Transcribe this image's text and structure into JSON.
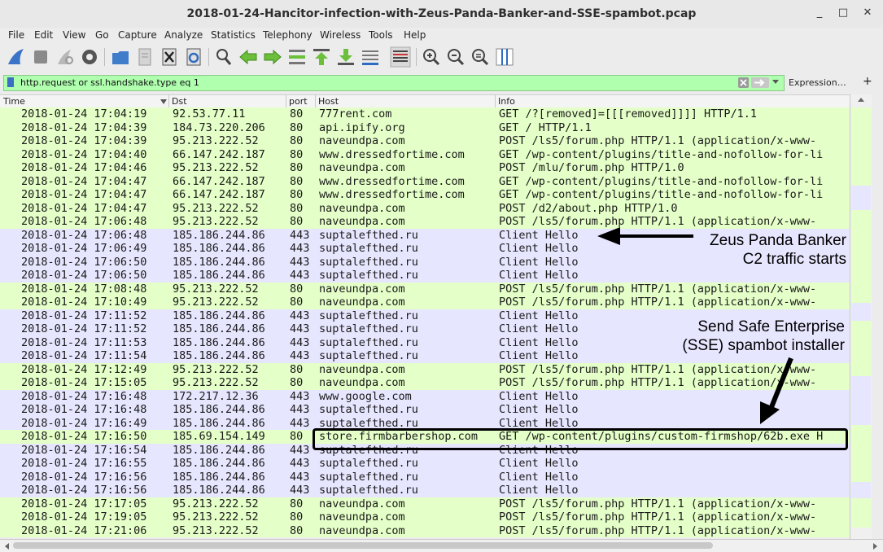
{
  "window": {
    "title": "2018-01-24-Hancitor-infection-with-Zeus-Panda-Banker-and-SSE-spambot.pcap",
    "minimize": "_",
    "maximize": "□",
    "close": "✕"
  },
  "menu": [
    "File",
    "Edit",
    "View",
    "Go",
    "Capture",
    "Analyze",
    "Statistics",
    "Telephony",
    "Wireless",
    "Tools",
    "Help"
  ],
  "toolbar_icons": [
    "shark-fin-icon",
    "stop-icon",
    "restart-icon",
    "options-icon",
    "open-file-icon",
    "file-icon",
    "close-file-icon",
    "reload-icon",
    "find-icon",
    "back-icon",
    "forward-icon",
    "goto-packet-icon",
    "first-packet-icon",
    "last-packet-icon",
    "autoscroll-icon",
    "colorize-icon",
    "zoom-in-icon",
    "zoom-out-icon",
    "zoom-reset-icon",
    "resize-columns-icon"
  ],
  "filter": {
    "value": "http.request or ssl.handshake.type eq 1",
    "expression_label": "Expression…",
    "add_label": "+"
  },
  "columns": {
    "time": "Time",
    "dst": "Dst",
    "port": "port",
    "host": "Host",
    "info": "Info"
  },
  "packets": [
    {
      "time": "2018-01-24 17:04:19",
      "dst": "92.53.77.11",
      "port": "80",
      "host": "777rent.com",
      "info": "GET /?[removed]=[[[removed]]]] HTTP/1.1",
      "type": "http"
    },
    {
      "time": "2018-01-24 17:04:39",
      "dst": "184.73.220.206",
      "port": "80",
      "host": "api.ipify.org",
      "info": "GET / HTTP/1.1",
      "type": "http"
    },
    {
      "time": "2018-01-24 17:04:39",
      "dst": "95.213.222.52",
      "port": "80",
      "host": "naveundpa.com",
      "info": "POST /ls5/forum.php HTTP/1.1  (application/x-www-",
      "type": "http"
    },
    {
      "time": "2018-01-24 17:04:40",
      "dst": "66.147.242.187",
      "port": "80",
      "host": "www.dressedfortime.com",
      "info": "GET /wp-content/plugins/title-and-nofollow-for-li",
      "type": "http"
    },
    {
      "time": "2018-01-24 17:04:46",
      "dst": "95.213.222.52",
      "port": "80",
      "host": "naveundpa.com",
      "info": "POST /mlu/forum.php HTTP/1.0",
      "type": "http"
    },
    {
      "time": "2018-01-24 17:04:47",
      "dst": "66.147.242.187",
      "port": "80",
      "host": "www.dressedfortime.com",
      "info": "GET /wp-content/plugins/title-and-nofollow-for-li",
      "type": "http"
    },
    {
      "time": "2018-01-24 17:04:47",
      "dst": "66.147.242.187",
      "port": "80",
      "host": "www.dressedfortime.com",
      "info": "GET /wp-content/plugins/title-and-nofollow-for-li",
      "type": "http"
    },
    {
      "time": "2018-01-24 17:04:47",
      "dst": "95.213.222.52",
      "port": "80",
      "host": "naveundpa.com",
      "info": "POST /d2/about.php HTTP/1.0",
      "type": "http"
    },
    {
      "time": "2018-01-24 17:06:48",
      "dst": "95.213.222.52",
      "port": "80",
      "host": "naveundpa.com",
      "info": "POST /ls5/forum.php HTTP/1.1  (application/x-www-",
      "type": "http"
    },
    {
      "time": "2018-01-24 17:06:48",
      "dst": "185.186.244.86",
      "port": "443",
      "host": "suptalefthed.ru",
      "info": "Client Hello",
      "type": "tls"
    },
    {
      "time": "2018-01-24 17:06:49",
      "dst": "185.186.244.86",
      "port": "443",
      "host": "suptalefthed.ru",
      "info": "Client Hello",
      "type": "tls"
    },
    {
      "time": "2018-01-24 17:06:50",
      "dst": "185.186.244.86",
      "port": "443",
      "host": "suptalefthed.ru",
      "info": "Client Hello",
      "type": "tls"
    },
    {
      "time": "2018-01-24 17:06:50",
      "dst": "185.186.244.86",
      "port": "443",
      "host": "suptalefthed.ru",
      "info": "Client Hello",
      "type": "tls"
    },
    {
      "time": "2018-01-24 17:08:48",
      "dst": "95.213.222.52",
      "port": "80",
      "host": "naveundpa.com",
      "info": "POST /ls5/forum.php HTTP/1.1  (application/x-www-",
      "type": "http"
    },
    {
      "time": "2018-01-24 17:10:49",
      "dst": "95.213.222.52",
      "port": "80",
      "host": "naveundpa.com",
      "info": "POST /ls5/forum.php HTTP/1.1  (application/x-www-",
      "type": "http"
    },
    {
      "time": "2018-01-24 17:11:52",
      "dst": "185.186.244.86",
      "port": "443",
      "host": "suptalefthed.ru",
      "info": "Client Hello",
      "type": "tls"
    },
    {
      "time": "2018-01-24 17:11:52",
      "dst": "185.186.244.86",
      "port": "443",
      "host": "suptalefthed.ru",
      "info": "Client Hello",
      "type": "tls"
    },
    {
      "time": "2018-01-24 17:11:53",
      "dst": "185.186.244.86",
      "port": "443",
      "host": "suptalefthed.ru",
      "info": "Client Hello",
      "type": "tls"
    },
    {
      "time": "2018-01-24 17:11:54",
      "dst": "185.186.244.86",
      "port": "443",
      "host": "suptalefthed.ru",
      "info": "Client Hello",
      "type": "tls"
    },
    {
      "time": "2018-01-24 17:12:49",
      "dst": "95.213.222.52",
      "port": "80",
      "host": "naveundpa.com",
      "info": "POST /ls5/forum.php HTTP/1.1  (application/x-www-",
      "type": "http"
    },
    {
      "time": "2018-01-24 17:15:05",
      "dst": "95.213.222.52",
      "port": "80",
      "host": "naveundpa.com",
      "info": "POST /ls5/forum.php HTTP/1.1  (application/x-www-",
      "type": "http"
    },
    {
      "time": "2018-01-24 17:16:48",
      "dst": "172.217.12.36",
      "port": "443",
      "host": "www.google.com",
      "info": "Client Hello",
      "type": "tls"
    },
    {
      "time": "2018-01-24 17:16:48",
      "dst": "185.186.244.86",
      "port": "443",
      "host": "suptalefthed.ru",
      "info": "Client Hello",
      "type": "tls"
    },
    {
      "time": "2018-01-24 17:16:49",
      "dst": "185.186.244.86",
      "port": "443",
      "host": "suptalefthed.ru",
      "info": "Client Hello",
      "type": "tls"
    },
    {
      "time": "2018-01-24 17:16:50",
      "dst": "185.69.154.149",
      "port": "80",
      "host": "store.firmbarbershop.com",
      "info": "GET /wp-content/plugins/custom-firmshop/62b.exe H",
      "type": "http"
    },
    {
      "time": "2018-01-24 17:16:54",
      "dst": "185.186.244.86",
      "port": "443",
      "host": "suptalefthed.ru",
      "info": "Client Hello",
      "type": "tls"
    },
    {
      "time": "2018-01-24 17:16:55",
      "dst": "185.186.244.86",
      "port": "443",
      "host": "suptalefthed.ru",
      "info": "Client Hello",
      "type": "tls"
    },
    {
      "time": "2018-01-24 17:16:56",
      "dst": "185.186.244.86",
      "port": "443",
      "host": "suptalefthed.ru",
      "info": "Client Hello",
      "type": "tls"
    },
    {
      "time": "2018-01-24 17:16:56",
      "dst": "185.186.244.86",
      "port": "443",
      "host": "suptalefthed.ru",
      "info": "Client Hello",
      "type": "tls"
    },
    {
      "time": "2018-01-24 17:17:05",
      "dst": "95.213.222.52",
      "port": "80",
      "host": "naveundpa.com",
      "info": "POST /ls5/forum.php HTTP/1.1  (application/x-www-",
      "type": "http"
    },
    {
      "time": "2018-01-24 17:19:05",
      "dst": "95.213.222.52",
      "port": "80",
      "host": "naveundpa.com",
      "info": "POST /ls5/forum.php HTTP/1.1  (application/x-www-",
      "type": "http"
    },
    {
      "time": "2018-01-24 17:21:06",
      "dst": "95.213.222.52",
      "port": "80",
      "host": "naveundpa.com",
      "info": "POST /ls5/forum.php HTTP/1.1  (application/x-www-",
      "type": "http"
    }
  ],
  "annotations": {
    "zeus_line1": "Zeus Panda Banker",
    "zeus_line2": "C2 traffic starts",
    "sse_line1": "Send Safe Enterprise",
    "sse_line2": "(SSE) spambot installer"
  },
  "colors": {
    "http_row": "#e4ffc7",
    "tls_row": "#e7e6ff",
    "filter_bg": "#afffaf"
  }
}
